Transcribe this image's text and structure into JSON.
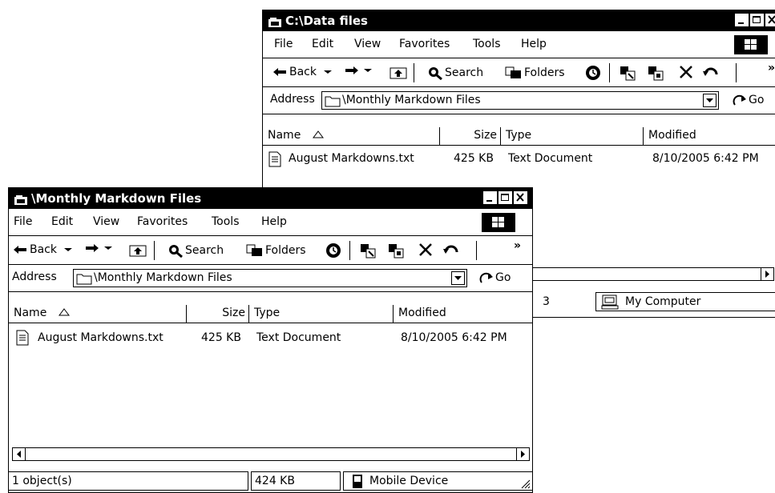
{
  "back_window": {
    "title": "C:\\Data files",
    "menu": [
      "File",
      "Edit",
      "View",
      "Favorites",
      "Tools",
      "Help"
    ],
    "toolbar": {
      "back": "Back",
      "search": "Search",
      "folders": "Folders",
      "more": "»"
    },
    "address": {
      "label": "Address",
      "value": "\\Monthly Markdown Files",
      "go": "Go"
    },
    "columns": [
      "Name",
      "Size",
      "Type",
      "Modified"
    ],
    "files": [
      {
        "name": "August Markdowns.txt",
        "size": "425 KB",
        "type": "Text Document",
        "modified": "8/10/2005 6:42 PM"
      }
    ],
    "status": {
      "size_fragment": "3",
      "location": "My Computer"
    }
  },
  "front_window": {
    "title": "\\Monthly Markdown Files",
    "menu": [
      "File",
      "Edit",
      "View",
      "Favorites",
      "Tools",
      "Help"
    ],
    "toolbar": {
      "back": "Back",
      "search": "Search",
      "folders": "Folders",
      "more": "»"
    },
    "address": {
      "label": "Address",
      "value": "\\Monthly Markdown Files",
      "go": "Go"
    },
    "columns": [
      "Name",
      "Size",
      "Type",
      "Modified"
    ],
    "files": [
      {
        "name": "August Markdowns.txt",
        "size": "425 KB",
        "type": "Text Document",
        "modified": "8/10/2005 6:42 PM"
      }
    ],
    "status": {
      "objects": "1 object(s)",
      "size": "424 KB",
      "location": "Mobile Device"
    }
  },
  "icons": [
    "window-icon",
    "minimize-icon",
    "maximize-icon",
    "close-icon",
    "windows-logo-icon",
    "back-arrow-icon",
    "forward-arrow-icon",
    "up-folder-icon",
    "search-icon",
    "folders-icon",
    "history-icon",
    "move-to-icon",
    "copy-to-icon",
    "delete-icon",
    "undo-icon",
    "folder-icon",
    "go-icon",
    "text-file-icon",
    "my-computer-icon",
    "mobile-device-icon",
    "scroll-left-icon",
    "scroll-right-icon",
    "dropdown-arrow-icon",
    "sort-ascending-icon",
    "resize-grip-icon"
  ]
}
